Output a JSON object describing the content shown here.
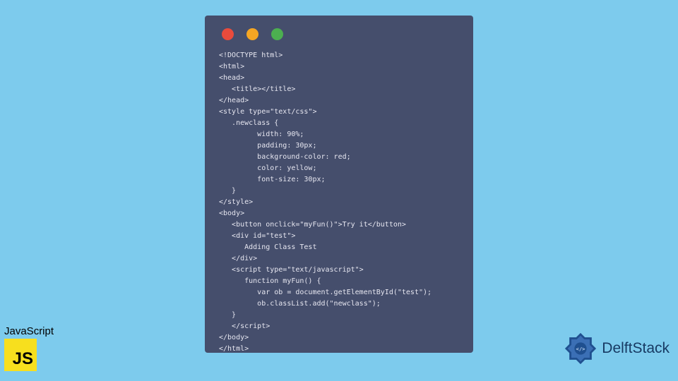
{
  "window": {
    "traffic_red": "close",
    "traffic_yellow": "minimize",
    "traffic_green": "zoom"
  },
  "code": "<!DOCTYPE html>\n<html>\n<head>\n   <title></title>\n</head>\n<style type=\"text/css\">\n   .newclass {\n         width: 90%;\n         padding: 30px;\n         background-color: red;\n         color: yellow;\n         font-size: 30px;\n   }\n</style>\n<body>\n   <button onclick=\"myFun()\">Try it</button>\n   <div id=\"test\">\n      Adding Class Test\n   </div>\n   <script type=\"text/javascript\">\n      function myFun() {\n         var ob = document.getElementById(\"test\");\n         ob.classList.add(\"newclass\");\n   }\n   </script>\n</body>\n</html>",
  "js_badge": {
    "label": "JavaScript",
    "logo_text": "JS"
  },
  "delft": {
    "label": "DelftStack"
  }
}
